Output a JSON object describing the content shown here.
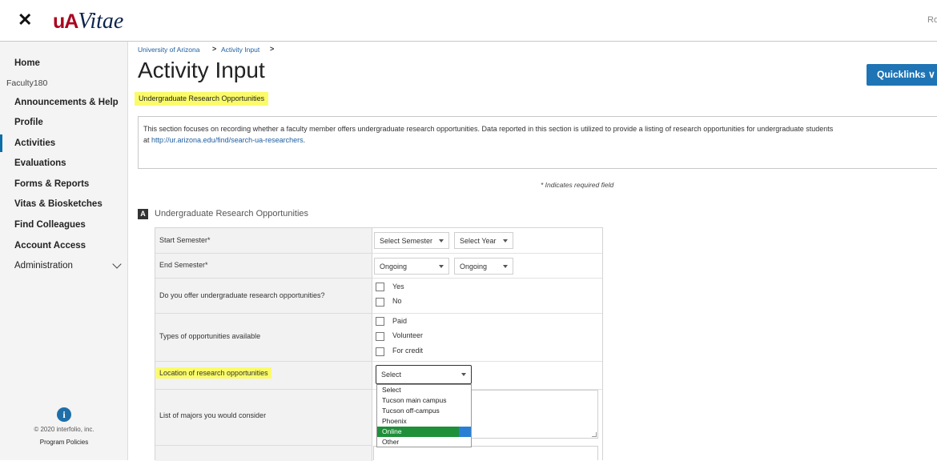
{
  "topbar": {
    "close_glyph": "✕",
    "logo_ua": "uA",
    "logo_vitae": "Vitae",
    "right_text": "Ro"
  },
  "sidebar": {
    "home": "Home",
    "group": "Faculty180",
    "items": [
      "Announcements & Help",
      "Profile",
      "Activities",
      "Evaluations",
      "Forms & Reports",
      "Vitas & Biosketches",
      "Find Colleagues",
      "Account Access",
      "Administration"
    ],
    "active": "Activities",
    "info_glyph": "i",
    "copyright": "© 2020 interfolio, inc.",
    "policies": "Program Policies"
  },
  "breadcrumb": [
    "University of Arizona",
    "Activity Input"
  ],
  "breadcrumb_sep": ">",
  "page_title": "Activity Input",
  "quicklinks": "Quicklinks ∨",
  "subtitle": "Undergraduate Research Opportunities",
  "description": {
    "line1": "This section focuses on recording whether a faculty member offers undergraduate research opportunities.  Data reported in this section is utilized to provide a listing of research opportunities for undergraduate students",
    "line2_prefix": "at ",
    "link": "http://ur.arizona.edu/find/search-ua-researchers",
    "line2_suffix": "."
  },
  "required_note": "* Indicates required field",
  "section": {
    "badge": "A",
    "title": "Undergraduate Research Opportunities"
  },
  "form": {
    "start_semester": {
      "label": "Start Semester*",
      "semester": "Select Semester",
      "year": "Select Year"
    },
    "end_semester": {
      "label": "End Semester*",
      "semester": "Ongoing",
      "year": "Ongoing"
    },
    "offer": {
      "label": "Do you offer undergraduate research opportunities?",
      "options": [
        "Yes",
        "No"
      ]
    },
    "types": {
      "label": "Types of opportunities available",
      "options": [
        "Paid",
        "Volunteer",
        "For credit"
      ]
    },
    "location": {
      "label": "Location of research opportunities",
      "value": "Select"
    },
    "majors": {
      "label": "List of majors you would consider"
    }
  },
  "dropdown": {
    "options": [
      "Select",
      "Tucson main campus",
      "Tucson off-campus",
      "Phoenix",
      "Online",
      "Other"
    ],
    "highlighted": "Online"
  },
  "colors": {
    "accent": "#1e74b4",
    "brand": "#ab0520",
    "highlight": "#fbfb6a",
    "selected_option": "#1f8f3a"
  }
}
